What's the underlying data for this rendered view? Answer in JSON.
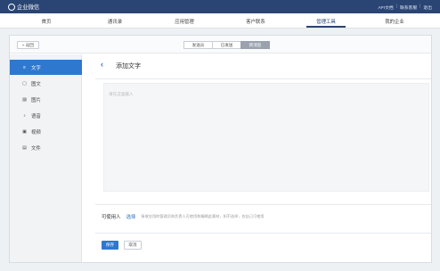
{
  "topbar": {
    "app_title": "企业微信",
    "links": [
      "API文档",
      "联系客服",
      "退出"
    ]
  },
  "nav": {
    "items": [
      "首页",
      "通讯录",
      "应用管理",
      "客户联系",
      "管理工具",
      "我的企业"
    ],
    "active": "管理工具"
  },
  "subheader": {
    "back_label": "« 返回",
    "tabs": [
      "发送员",
      "已发送",
      "新消息"
    ],
    "active_tab": "新消息"
  },
  "sidebar": {
    "items": [
      {
        "label": "文字",
        "icon": "text-icon"
      },
      {
        "label": "图文",
        "icon": "article-icon"
      },
      {
        "label": "图片",
        "icon": "image-icon"
      },
      {
        "label": "语音",
        "icon": "voice-icon"
      },
      {
        "label": "视频",
        "icon": "video-icon"
      },
      {
        "label": "文件",
        "icon": "file-icon"
      }
    ],
    "active": "文字"
  },
  "content": {
    "title": "添加文字",
    "editor_placeholder": "请在这里输入",
    "users_label": "可使用人",
    "users_choose": "选择",
    "users_hint": "接收应用的管理员和负责人可使用和编辑此素材，如不选择，仅自己可使用",
    "save_label": "保存",
    "cancel_label": "取消"
  },
  "colors": {
    "topbar": "#2a4573",
    "accent": "#2f78cf"
  }
}
